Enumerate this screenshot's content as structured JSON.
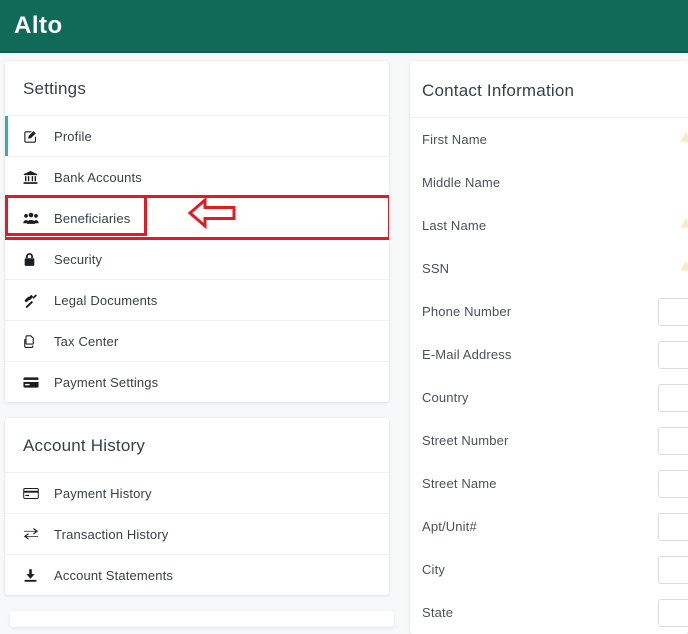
{
  "header": {
    "brand": "Alto",
    "bg_color": "#106a58",
    "logo_color": "#ffffff"
  },
  "annotation": {
    "highlight_color": "#e01b24",
    "highlight_target": "Beneficiaries",
    "arrow_direction": "left"
  },
  "settings_card": {
    "title": "Settings",
    "active_accent_color": "#34b3a0",
    "items": [
      {
        "label": "Profile",
        "icon": "edit-square-icon",
        "active": true
      },
      {
        "label": "Bank Accounts",
        "icon": "bank-icon",
        "active": false
      },
      {
        "label": "Beneficiaries",
        "icon": "users-group-icon",
        "active": false
      },
      {
        "label": "Security",
        "icon": "lock-icon",
        "active": false
      },
      {
        "label": "Legal Documents",
        "icon": "gavel-icon",
        "active": false
      },
      {
        "label": "Tax Center",
        "icon": "copy-documents-icon",
        "active": false
      },
      {
        "label": "Payment Settings",
        "icon": "credit-card-icon",
        "active": false
      }
    ]
  },
  "account_history_card": {
    "title": "Account History",
    "items": [
      {
        "label": "Payment History",
        "icon": "credit-card-icon"
      },
      {
        "label": "Transaction History",
        "icon": "exchange-arrows-icon"
      },
      {
        "label": "Account Statements",
        "icon": "download-icon"
      }
    ]
  },
  "contact_card": {
    "title": "Contact Information",
    "fields": [
      {
        "label": "First Name",
        "value": "",
        "warning": true
      },
      {
        "label": "Middle Name",
        "value": "",
        "warning": false
      },
      {
        "label": "Last Name",
        "value": "",
        "warning": true
      },
      {
        "label": "SSN",
        "value": "",
        "warning": true
      },
      {
        "label": "Phone Number",
        "value": "",
        "warning": false
      },
      {
        "label": "E-Mail Address",
        "value": "",
        "warning": false
      },
      {
        "label": "Country",
        "value": "",
        "warning": false
      },
      {
        "label": "Street Number",
        "value": "",
        "warning": false
      },
      {
        "label": "Street Name",
        "value": "",
        "warning": false
      },
      {
        "label": "Apt/Unit#",
        "value": "",
        "warning": false
      },
      {
        "label": "City",
        "value": "",
        "warning": false
      },
      {
        "label": "State",
        "value": "",
        "warning": false
      }
    ]
  }
}
